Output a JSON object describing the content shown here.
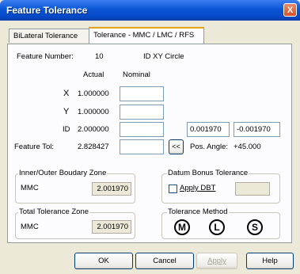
{
  "window": {
    "title": "Feature Tolerance",
    "close_glyph": "X"
  },
  "tabs": [
    {
      "label": "BiLateral Tolerance"
    },
    {
      "label": "Tolerance - MMC / LMC / RFS"
    }
  ],
  "feature": {
    "number_label": "Feature Number:",
    "number": "10",
    "name": "ID XY Circle"
  },
  "columns": {
    "actual": "Actual",
    "nominal": "Nominal"
  },
  "rows": [
    {
      "label": "X",
      "actual": "1.000000",
      "nominal": ""
    },
    {
      "label": "Y",
      "actual": "1.000000",
      "nominal": ""
    },
    {
      "label": "ID",
      "actual": "2.000000",
      "nominal": "",
      "plus_tol": "0.001970",
      "minus_tol": "-0.001970"
    },
    {
      "label": "Feature Tol:",
      "actual": "2.828427",
      "nominal": "",
      "copy_btn": "<<",
      "pos_angle_label": "Pos. Angle:",
      "pos_angle": "+45.000"
    }
  ],
  "inner_outer": {
    "title": "Inner/Outer Boudary Zone",
    "label": "MMC",
    "value": "2.001970"
  },
  "datum_bonus": {
    "title": "Datum Bonus Tolerance",
    "checkbox_label": "Apply DBT",
    "checked": false,
    "value": ""
  },
  "total_zone": {
    "title": "Total Tolerance Zone",
    "label": "MMC",
    "value": "2.001970"
  },
  "tol_method": {
    "title": "Tolerance Method",
    "symbols": [
      "M",
      "L",
      "S"
    ]
  },
  "buttons": {
    "ok": "OK",
    "cancel": "Cancel",
    "apply": "Apply",
    "help": "Help"
  }
}
